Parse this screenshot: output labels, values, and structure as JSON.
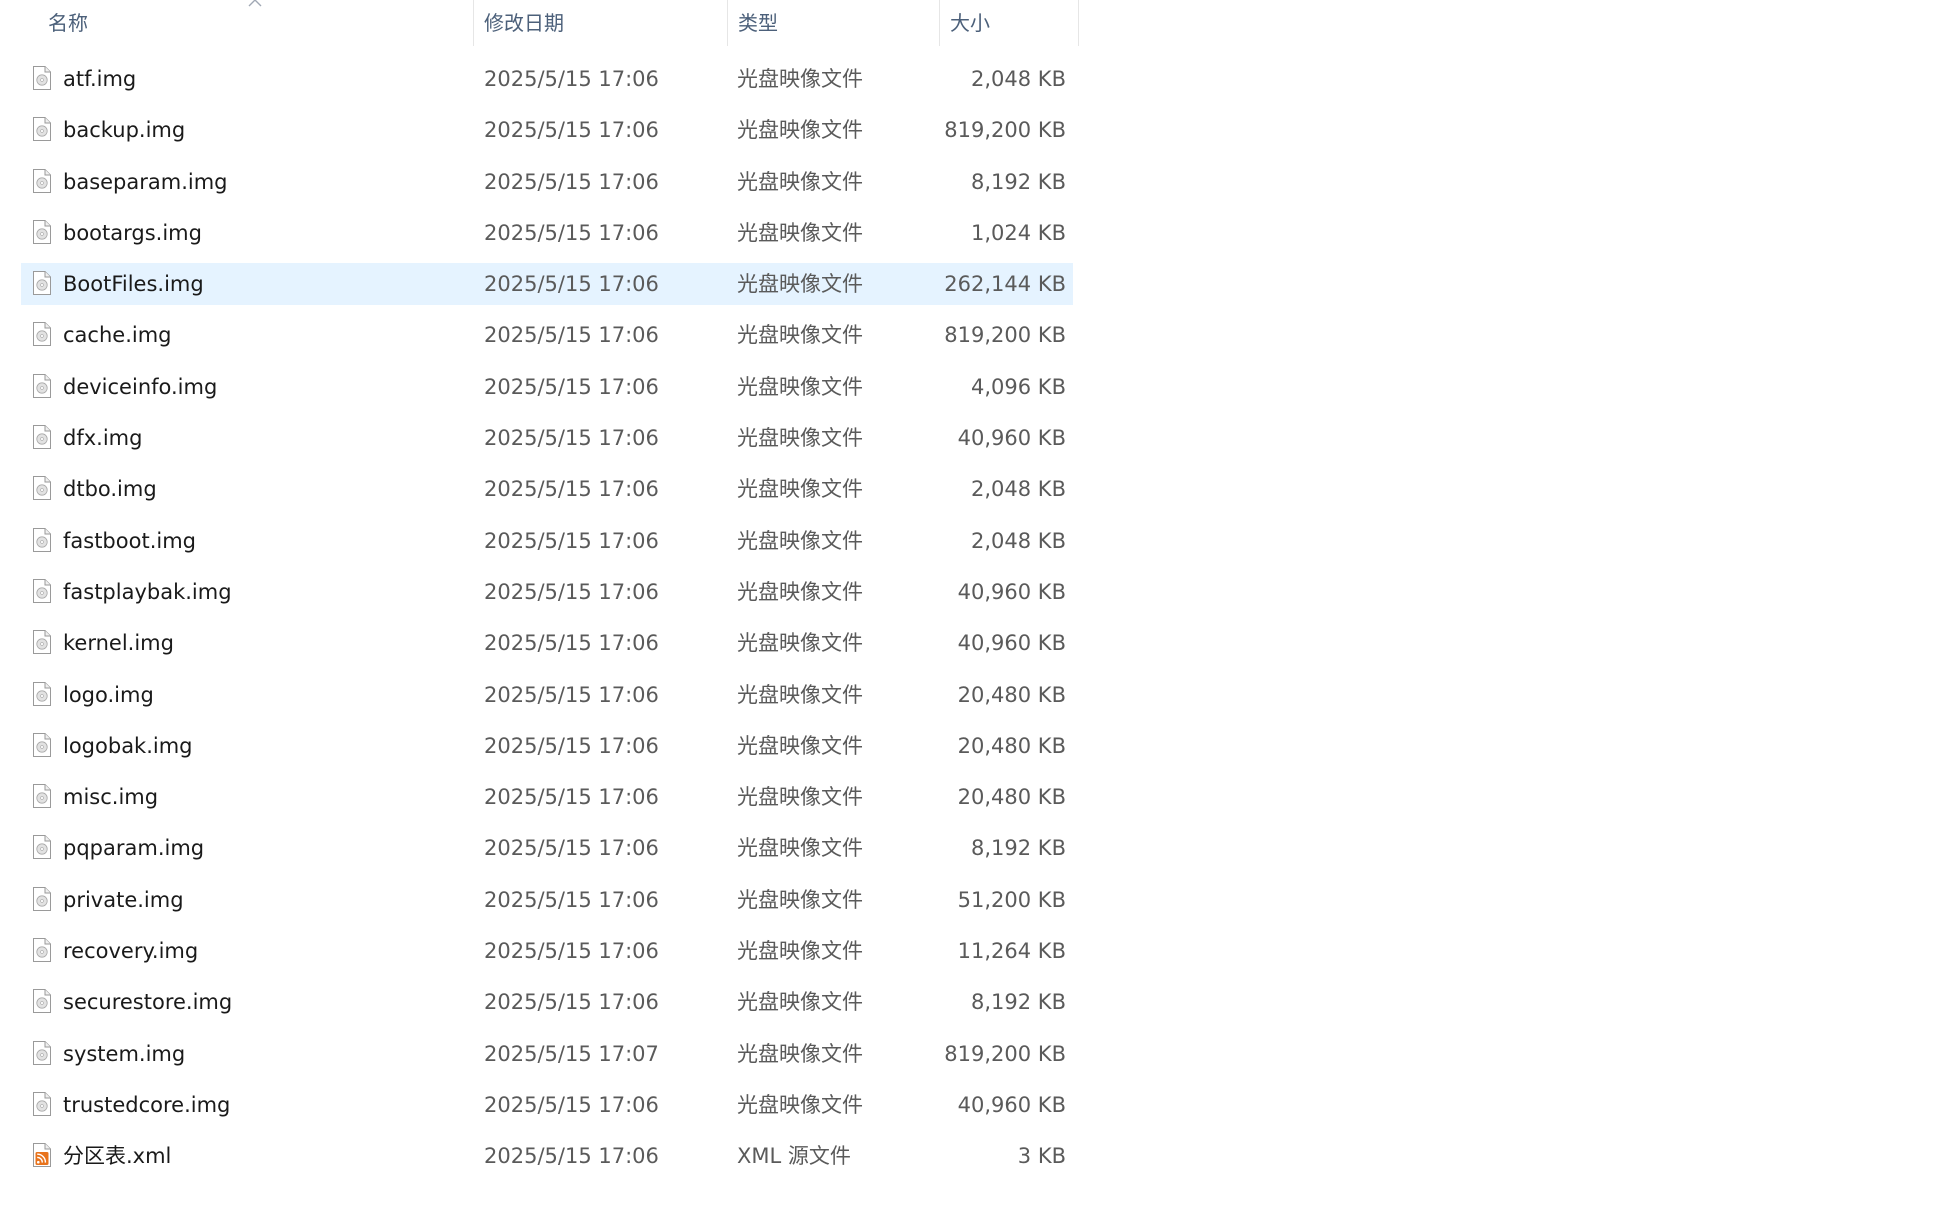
{
  "columns": {
    "name": "名称",
    "date": "修改日期",
    "type": "类型",
    "size": "大小"
  },
  "sort": {
    "column": "name",
    "direction": "ascending",
    "icon": "sort-ascending-caret-icon"
  },
  "colors": {
    "header_text": "#4c607a",
    "selected_row": "#e5f3ff",
    "secondary_text": "#5a5a5a"
  },
  "selected_index": 4,
  "files": [
    {
      "name": "atf.img",
      "date": "2025/5/15 17:06",
      "type": "光盘映像文件",
      "size": "2,048 KB",
      "icon": "disc-image-file-icon"
    },
    {
      "name": "backup.img",
      "date": "2025/5/15 17:06",
      "type": "光盘映像文件",
      "size": "819,200 KB",
      "icon": "disc-image-file-icon"
    },
    {
      "name": "baseparam.img",
      "date": "2025/5/15 17:06",
      "type": "光盘映像文件",
      "size": "8,192 KB",
      "icon": "disc-image-file-icon"
    },
    {
      "name": "bootargs.img",
      "date": "2025/5/15 17:06",
      "type": "光盘映像文件",
      "size": "1,024 KB",
      "icon": "disc-image-file-icon"
    },
    {
      "name": "BootFiles.img",
      "date": "2025/5/15 17:06",
      "type": "光盘映像文件",
      "size": "262,144 KB",
      "icon": "disc-image-file-icon"
    },
    {
      "name": "cache.img",
      "date": "2025/5/15 17:06",
      "type": "光盘映像文件",
      "size": "819,200 KB",
      "icon": "disc-image-file-icon"
    },
    {
      "name": "deviceinfo.img",
      "date": "2025/5/15 17:06",
      "type": "光盘映像文件",
      "size": "4,096 KB",
      "icon": "disc-image-file-icon"
    },
    {
      "name": "dfx.img",
      "date": "2025/5/15 17:06",
      "type": "光盘映像文件",
      "size": "40,960 KB",
      "icon": "disc-image-file-icon"
    },
    {
      "name": "dtbo.img",
      "date": "2025/5/15 17:06",
      "type": "光盘映像文件",
      "size": "2,048 KB",
      "icon": "disc-image-file-icon"
    },
    {
      "name": "fastboot.img",
      "date": "2025/5/15 17:06",
      "type": "光盘映像文件",
      "size": "2,048 KB",
      "icon": "disc-image-file-icon"
    },
    {
      "name": "fastplaybak.img",
      "date": "2025/5/15 17:06",
      "type": "光盘映像文件",
      "size": "40,960 KB",
      "icon": "disc-image-file-icon"
    },
    {
      "name": "kernel.img",
      "date": "2025/5/15 17:06",
      "type": "光盘映像文件",
      "size": "40,960 KB",
      "icon": "disc-image-file-icon"
    },
    {
      "name": "logo.img",
      "date": "2025/5/15 17:06",
      "type": "光盘映像文件",
      "size": "20,480 KB",
      "icon": "disc-image-file-icon"
    },
    {
      "name": "logobak.img",
      "date": "2025/5/15 17:06",
      "type": "光盘映像文件",
      "size": "20,480 KB",
      "icon": "disc-image-file-icon"
    },
    {
      "name": "misc.img",
      "date": "2025/5/15 17:06",
      "type": "光盘映像文件",
      "size": "20,480 KB",
      "icon": "disc-image-file-icon"
    },
    {
      "name": "pqparam.img",
      "date": "2025/5/15 17:06",
      "type": "光盘映像文件",
      "size": "8,192 KB",
      "icon": "disc-image-file-icon"
    },
    {
      "name": "private.img",
      "date": "2025/5/15 17:06",
      "type": "光盘映像文件",
      "size": "51,200 KB",
      "icon": "disc-image-file-icon"
    },
    {
      "name": "recovery.img",
      "date": "2025/5/15 17:06",
      "type": "光盘映像文件",
      "size": "11,264 KB",
      "icon": "disc-image-file-icon"
    },
    {
      "name": "securestore.img",
      "date": "2025/5/15 17:06",
      "type": "光盘映像文件",
      "size": "8,192 KB",
      "icon": "disc-image-file-icon"
    },
    {
      "name": "system.img",
      "date": "2025/5/15 17:07",
      "type": "光盘映像文件",
      "size": "819,200 KB",
      "icon": "disc-image-file-icon"
    },
    {
      "name": "trustedcore.img",
      "date": "2025/5/15 17:06",
      "type": "光盘映像文件",
      "size": "40,960 KB",
      "icon": "disc-image-file-icon"
    },
    {
      "name": "分区表.xml",
      "date": "2025/5/15 17:06",
      "type": "XML 源文件",
      "size": "3 KB",
      "icon": "xml-rss-file-icon"
    }
  ]
}
